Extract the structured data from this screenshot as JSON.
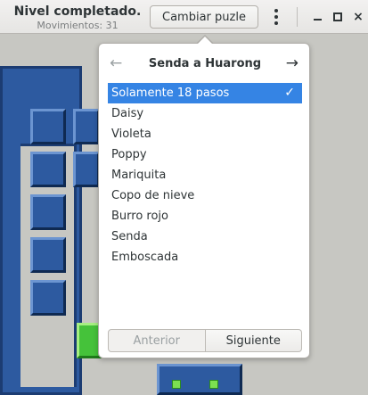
{
  "header": {
    "title": "Nivel completado.",
    "subtitle": "Movimientos: 31",
    "change_puzzle_label": "Cambiar puzle",
    "menu_icon": "vertical-dots-icon",
    "minimize_icon": "minimize-icon",
    "maximize_icon": "maximize-icon",
    "close_icon": "close-icon",
    "close_glyph": "×"
  },
  "popover": {
    "title": "Senda a Huarong",
    "prev_arrow": "←",
    "next_arrow": "→",
    "selected_check": "✓",
    "items": [
      {
        "label": "Solamente 18 pasos",
        "selected": true
      },
      {
        "label": "Daisy"
      },
      {
        "label": "Violeta"
      },
      {
        "label": "Poppy"
      },
      {
        "label": "Mariquita"
      },
      {
        "label": "Copo de nieve"
      },
      {
        "label": "Burro rojo"
      },
      {
        "label": "Senda"
      },
      {
        "label": "Emboscada"
      }
    ],
    "prev_button": "Anterior",
    "next_button": "Siguiente"
  },
  "colors": {
    "accent": "#3584e4",
    "tile_blue": "#2d5aa0",
    "tile_green": "#45c23a"
  }
}
